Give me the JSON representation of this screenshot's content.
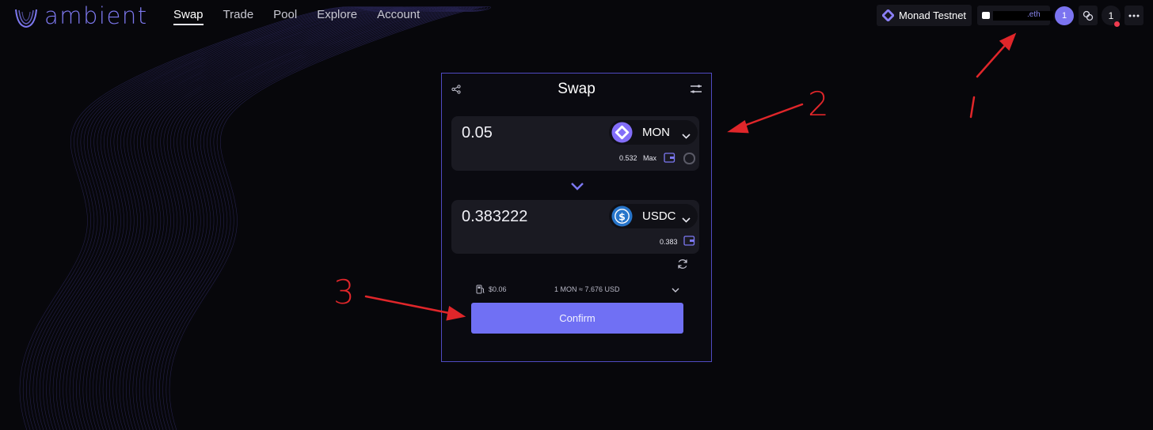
{
  "app": {
    "logo_text": "ambient"
  },
  "nav": {
    "items": [
      "Swap",
      "Trade",
      "Pool",
      "Explore",
      "Account"
    ],
    "active": "Swap"
  },
  "header": {
    "network_label": "Monad Testnet",
    "wallet_suffix": ".eth",
    "points_badge": "1",
    "notifications_count": "1"
  },
  "swap": {
    "title": "Swap",
    "from": {
      "amount": "0.05",
      "token": "MON",
      "balance": "0.532",
      "max_label": "Max"
    },
    "to": {
      "amount": "0.383222",
      "token": "USDC",
      "balance": "0.383"
    },
    "gas_fee": "$0.06",
    "rate": "1 MON ≈ 7.676 USD",
    "confirm_label": "Confirm"
  },
  "annotations": {
    "labels": [
      "1",
      "2",
      "3"
    ]
  },
  "colors": {
    "accent": "#7070f4",
    "background": "#07070b",
    "card_border": "#4f4ac2",
    "annotation_red": "#e0262a",
    "usdc_blue": "#2775ca"
  },
  "icons": [
    "share-icon",
    "settings-sliders-icon",
    "chevron-down-icon",
    "wallet-icon",
    "refresh-icon",
    "gas-pump-icon",
    "link-icon",
    "more-icon",
    "monad-icon",
    "usdc-icon"
  ]
}
